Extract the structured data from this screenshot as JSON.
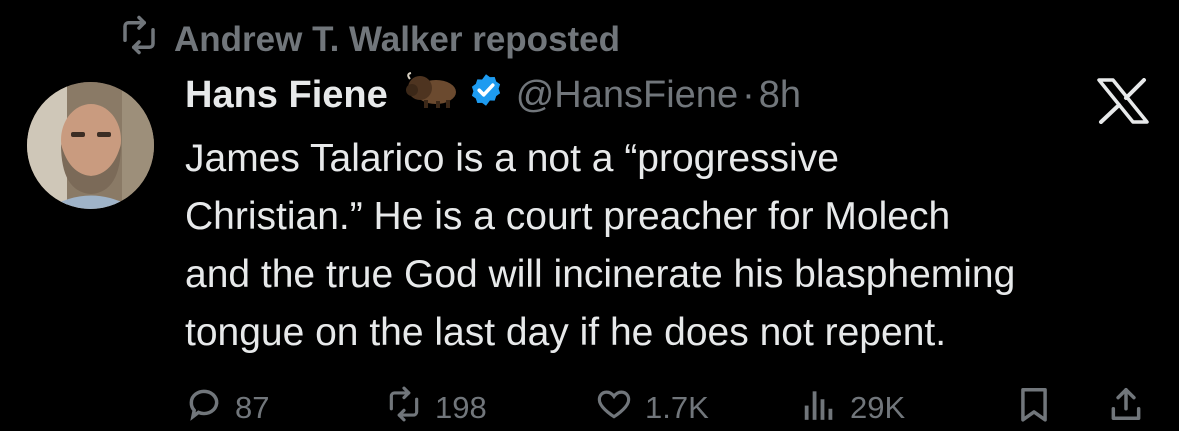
{
  "repost": {
    "text": "Andrew T. Walker reposted",
    "icon": "repost-icon"
  },
  "author": {
    "name": "Hans Fiene",
    "emoji_icon": "bison-icon",
    "verified_icon": "verified-badge-icon",
    "handle": "@HansFiene",
    "separator": "·",
    "time": "8h"
  },
  "platform_logo": "x-logo-icon",
  "tweet": {
    "lines": [
      "James Talarico is a not a “progressive",
      "Christian.” He is a court preacher for Molech",
      "and the true God will incinerate his blaspheming",
      "tongue on the last day if he does not repent."
    ]
  },
  "actions": {
    "replies": "87",
    "reposts": "198",
    "likes": "1.7K",
    "views": "29K"
  },
  "colors": {
    "background": "#000000",
    "text": "#e7e9ea",
    "muted": "#71767b",
    "verified": "#1d9bf0"
  }
}
